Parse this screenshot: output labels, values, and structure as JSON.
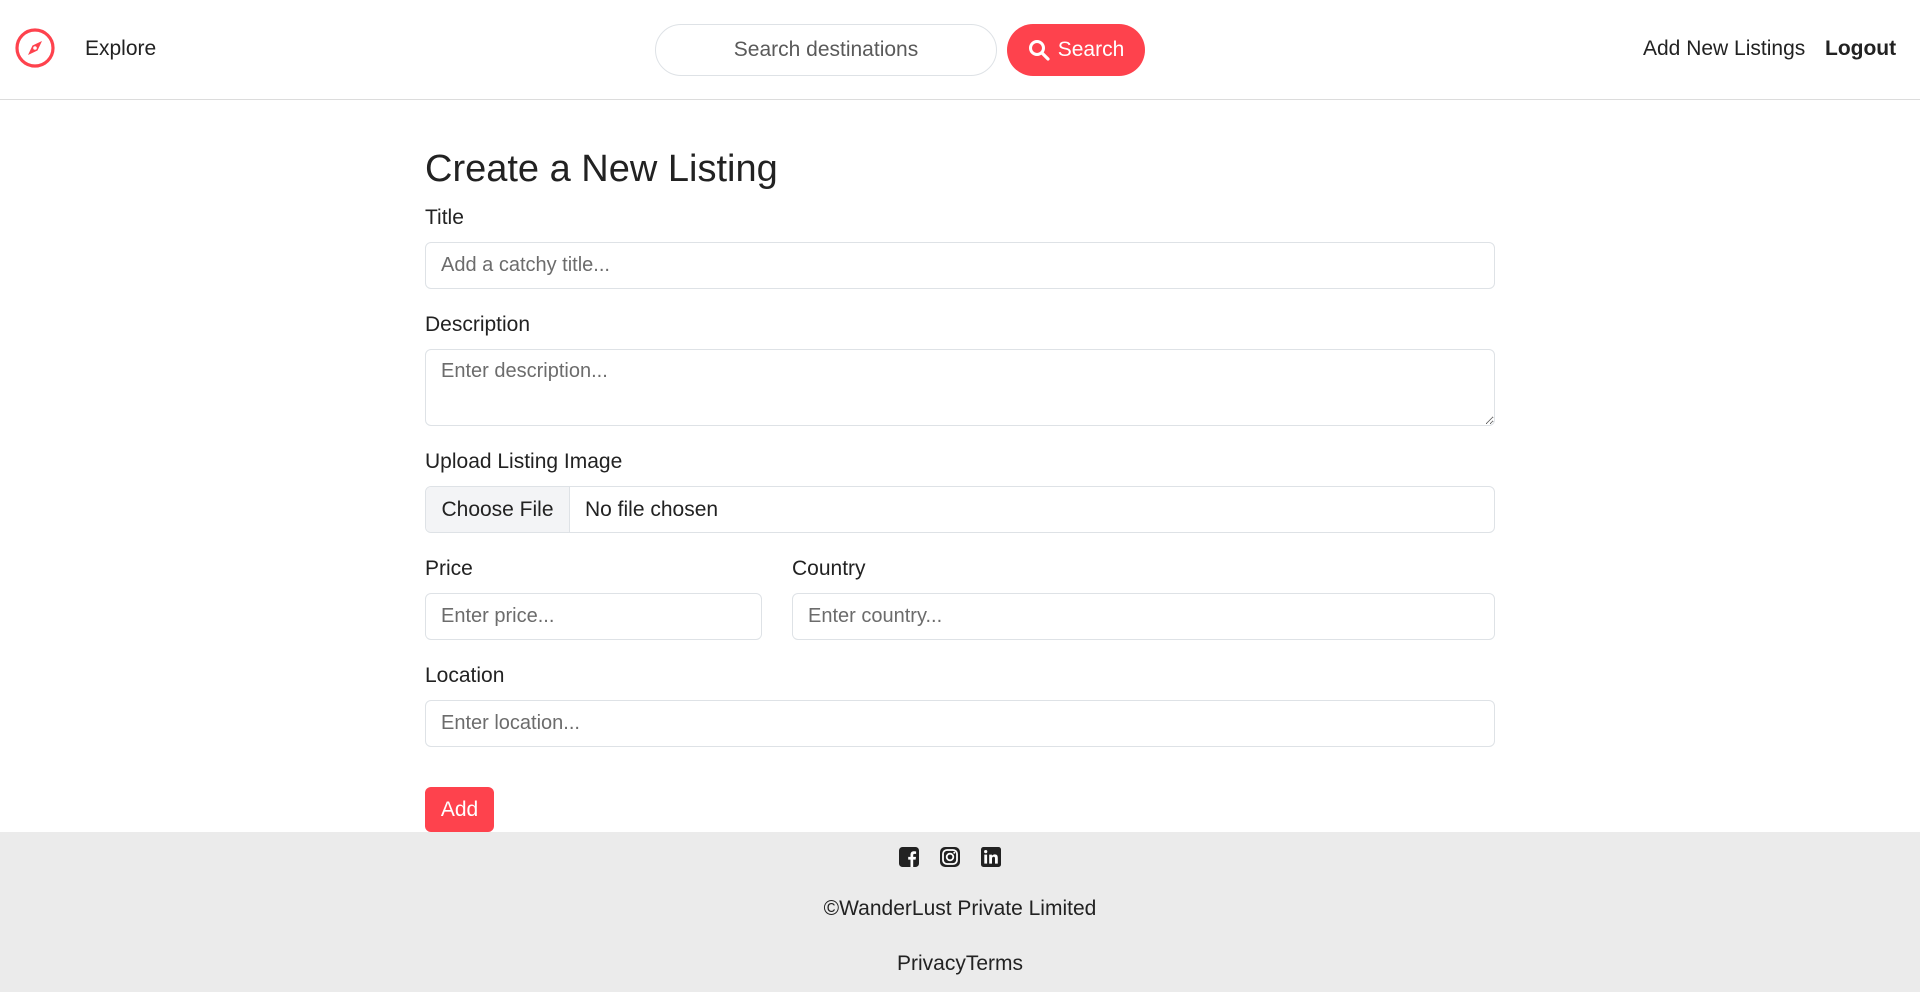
{
  "navbar": {
    "brand_icon": "compass-icon",
    "explore_label": "Explore",
    "search_placeholder": "Search destinations",
    "search_button_label": "Search",
    "add_listing_label": "Add New Listings",
    "logout_label": "Logout"
  },
  "form": {
    "heading": "Create a New Listing",
    "title_label": "Title",
    "title_placeholder": "Add a catchy title...",
    "description_label": "Description",
    "description_placeholder": "Enter description...",
    "image_label": "Upload Listing Image",
    "choose_file_label": "Choose File",
    "file_status": "No file chosen",
    "price_label": "Price",
    "price_placeholder": "Enter price...",
    "country_label": "Country",
    "country_placeholder": "Enter country...",
    "location_label": "Location",
    "location_placeholder": "Enter location...",
    "submit_label": "Add"
  },
  "footer": {
    "social_icons": [
      "facebook-icon",
      "instagram-icon",
      "linkedin-icon"
    ],
    "copyright": "©WanderLust Private Limited",
    "privacy_label": "Privacy",
    "terms_label": "Terms"
  },
  "colors": {
    "accent": "#fe424d",
    "footer_bg": "#ebebeb",
    "text": "#222222"
  }
}
